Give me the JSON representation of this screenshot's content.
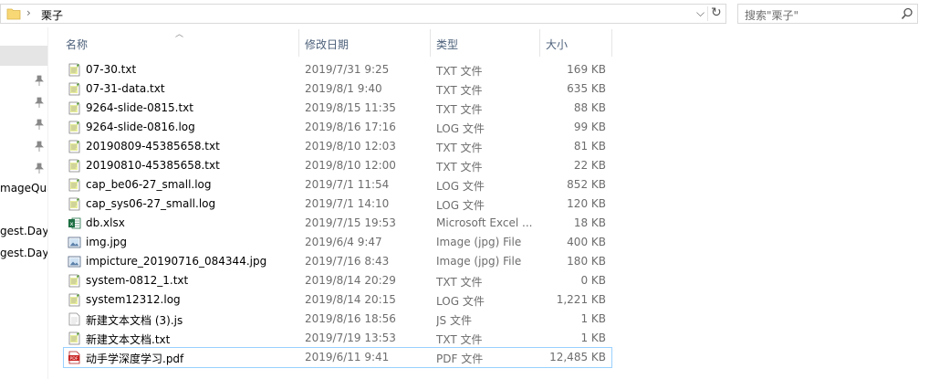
{
  "address": {
    "crumb": "栗子"
  },
  "search": {
    "placeholder": "搜索\"栗子\""
  },
  "nav": {
    "items": [
      "mageQua",
      "gest.Day.l",
      "gest.Day.l"
    ]
  },
  "columns": {
    "name": "名称",
    "date": "修改日期",
    "type": "类型",
    "size": "大小"
  },
  "files": [
    {
      "name": "07-30.txt",
      "date": "2019/7/31 9:25",
      "type": "TXT 文件",
      "size": "169 KB",
      "icon": "text-file-icon"
    },
    {
      "name": "07-31-data.txt",
      "date": "2019/8/1 9:40",
      "type": "TXT 文件",
      "size": "635 KB",
      "icon": "text-file-icon"
    },
    {
      "name": "9264-slide-0815.txt",
      "date": "2019/8/15 11:35",
      "type": "TXT 文件",
      "size": "88 KB",
      "icon": "text-file-icon"
    },
    {
      "name": "9264-slide-0816.log",
      "date": "2019/8/16 17:16",
      "type": "LOG 文件",
      "size": "99 KB",
      "icon": "text-file-icon"
    },
    {
      "name": "20190809-45385658.txt",
      "date": "2019/8/10 12:03",
      "type": "TXT 文件",
      "size": "81 KB",
      "icon": "text-file-icon"
    },
    {
      "name": "20190810-45385658.txt",
      "date": "2019/8/10 12:00",
      "type": "TXT 文件",
      "size": "22 KB",
      "icon": "text-file-icon"
    },
    {
      "name": "cap_be06-27_small.log",
      "date": "2019/7/1 11:54",
      "type": "LOG 文件",
      "size": "852 KB",
      "icon": "text-file-icon"
    },
    {
      "name": "cap_sys06-27_small.log",
      "date": "2019/7/1 14:10",
      "type": "LOG 文件",
      "size": "120 KB",
      "icon": "text-file-icon"
    },
    {
      "name": "db.xlsx",
      "date": "2019/7/15 19:53",
      "type": "Microsoft Excel ...",
      "size": "18 KB",
      "icon": "excel-file-icon"
    },
    {
      "name": "img.jpg",
      "date": "2019/6/4 9:47",
      "type": "Image (jpg) File",
      "size": "400 KB",
      "icon": "image-file-icon"
    },
    {
      "name": "impicture_20190716_084344.jpg",
      "date": "2019/7/16 8:43",
      "type": "Image (jpg) File",
      "size": "180 KB",
      "icon": "image-file-icon"
    },
    {
      "name": "system-0812_1.txt",
      "date": "2019/8/14 20:29",
      "type": "TXT 文件",
      "size": "0 KB",
      "icon": "text-file-icon"
    },
    {
      "name": "system12312.log",
      "date": "2019/8/14 20:15",
      "type": "LOG 文件",
      "size": "1,221 KB",
      "icon": "text-file-icon"
    },
    {
      "name": "新建文本文档 (3).js",
      "date": "2019/8/16 18:56",
      "type": "JS 文件",
      "size": "1 KB",
      "icon": "js-file-icon"
    },
    {
      "name": "新建文本文档.txt",
      "date": "2019/7/19 13:53",
      "type": "TXT 文件",
      "size": "1 KB",
      "icon": "text-file-icon"
    },
    {
      "name": "动手学深度学习.pdf",
      "date": "2019/6/11 9:41",
      "type": "PDF 文件",
      "size": "12,485 KB",
      "icon": "pdf-file-icon",
      "selected": true
    }
  ]
}
